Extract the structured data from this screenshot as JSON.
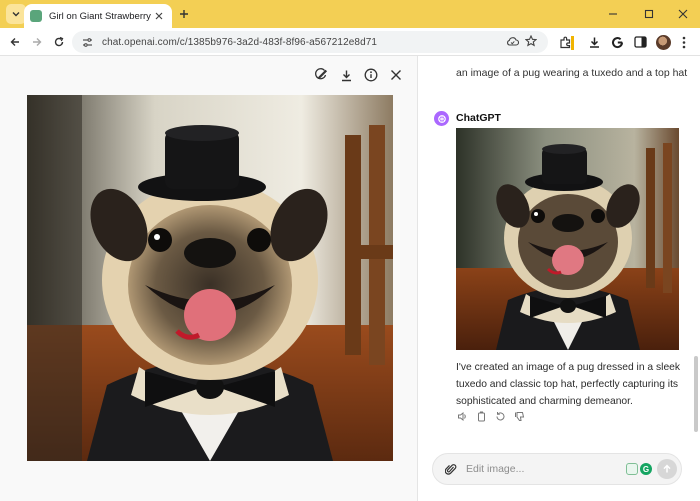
{
  "browser": {
    "tab_title": "Girl on Giant Strawberry",
    "url": "chat.openai.com/c/1385b976-3a2d-483f-8f96-a567212e8d71",
    "accent_color": "#f3cf54"
  },
  "image_panel": {
    "image_subject": "pug-in-tuxedo-and-top-hat",
    "tools": [
      "edit-icon",
      "download-icon",
      "info-icon",
      "close-icon"
    ]
  },
  "chat": {
    "user_prompt": "an image of a pug wearing a tuxedo and a top hat",
    "assistant_name": "ChatGPT",
    "assistant_reply": "I've created an image of a pug dressed in a sleek tuxedo and classic top hat, perfectly capturing its sophisticated and charming demeanor.",
    "composer_placeholder": "Edit image...",
    "extension_badge": "G"
  }
}
